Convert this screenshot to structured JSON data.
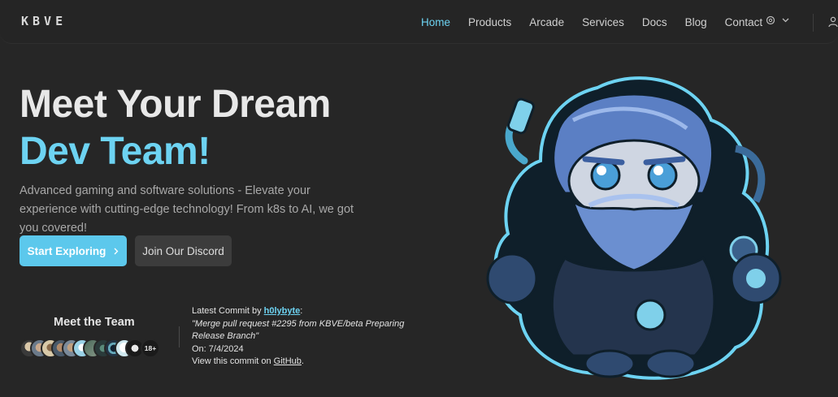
{
  "header": {
    "logo": "KBVE",
    "nav": [
      {
        "label": "Home",
        "active": true
      },
      {
        "label": "Products"
      },
      {
        "label": "Arcade"
      },
      {
        "label": "Services"
      },
      {
        "label": "Docs"
      },
      {
        "label": "Blog"
      },
      {
        "label": "Contact"
      }
    ],
    "theme_icon": "globe-icon",
    "user_icon": "user-icon"
  },
  "hero": {
    "title_line1": "Meet Your Dream",
    "title_line2": "Dev Team!",
    "subtitle": "Advanced gaming and software solutions - Elevate your experience with cutting-edge technology! From k8s to AI, we got you covered!",
    "primary_button": "Start Exploring",
    "secondary_button": "Join Our Discord"
  },
  "team": {
    "title": "Meet the Team",
    "more_count": "18+"
  },
  "commit": {
    "prefix": "Latest Commit by",
    "author": "h0lybyte",
    "colon": ":",
    "message": "\"Merge pull request #2295 from KBVE/beta Preparing Release Branch\"",
    "date_label": "On: 7/4/2024",
    "view_prefix": "View this commit on",
    "link": "GitHub",
    "period": "."
  },
  "colors": {
    "accent": "#6dd3f2",
    "background": "#262626",
    "button_primary": "#5cc8ec"
  }
}
